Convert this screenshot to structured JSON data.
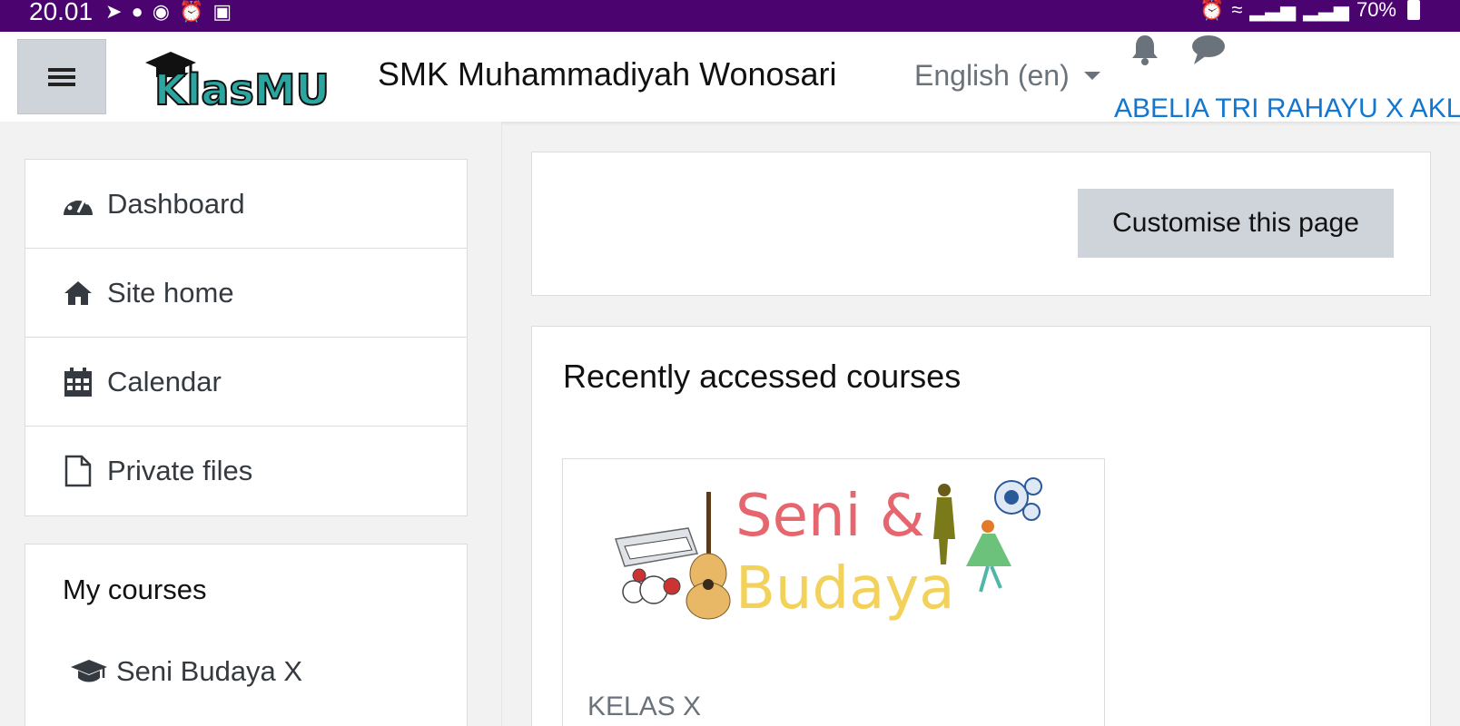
{
  "status_bar": {
    "time": "20.01",
    "notification_icons": [
      "telegram-icon",
      "chat-bubble-icon",
      "search-bubble-icon",
      "alarm-icon",
      "image-icon"
    ],
    "system_icons": [
      "alarm-icon",
      "wifi-icon",
      "signal-icon",
      "signal-icon"
    ],
    "battery": "70%",
    "background_color": "#4a036f"
  },
  "header": {
    "logo_text": "KlasMU",
    "site_name": "SMK Muhammadiyah Wonosari",
    "language": "English (en)",
    "user_name": "ABELIA TRI RAHAYU X AKL"
  },
  "sidebar": {
    "nav_items": [
      {
        "label": "Dashboard",
        "icon": "dashboard-icon"
      },
      {
        "label": "Site home",
        "icon": "home-icon"
      },
      {
        "label": "Calendar",
        "icon": "calendar-icon"
      },
      {
        "label": "Private files",
        "icon": "file-icon"
      }
    ],
    "my_courses": {
      "title": "My courses",
      "items": [
        {
          "label": "Seni Budaya X",
          "icon": "graduation-cap-icon"
        }
      ]
    }
  },
  "main": {
    "customise_button": "Customise this page",
    "recent_title": "Recently accessed courses",
    "course": {
      "image_text_line1": "Seni &",
      "image_text_line2": "Budaya",
      "category": "KELAS X"
    }
  },
  "colors": {
    "accent_link": "#1177d1",
    "button_gray": "#ced4da"
  }
}
